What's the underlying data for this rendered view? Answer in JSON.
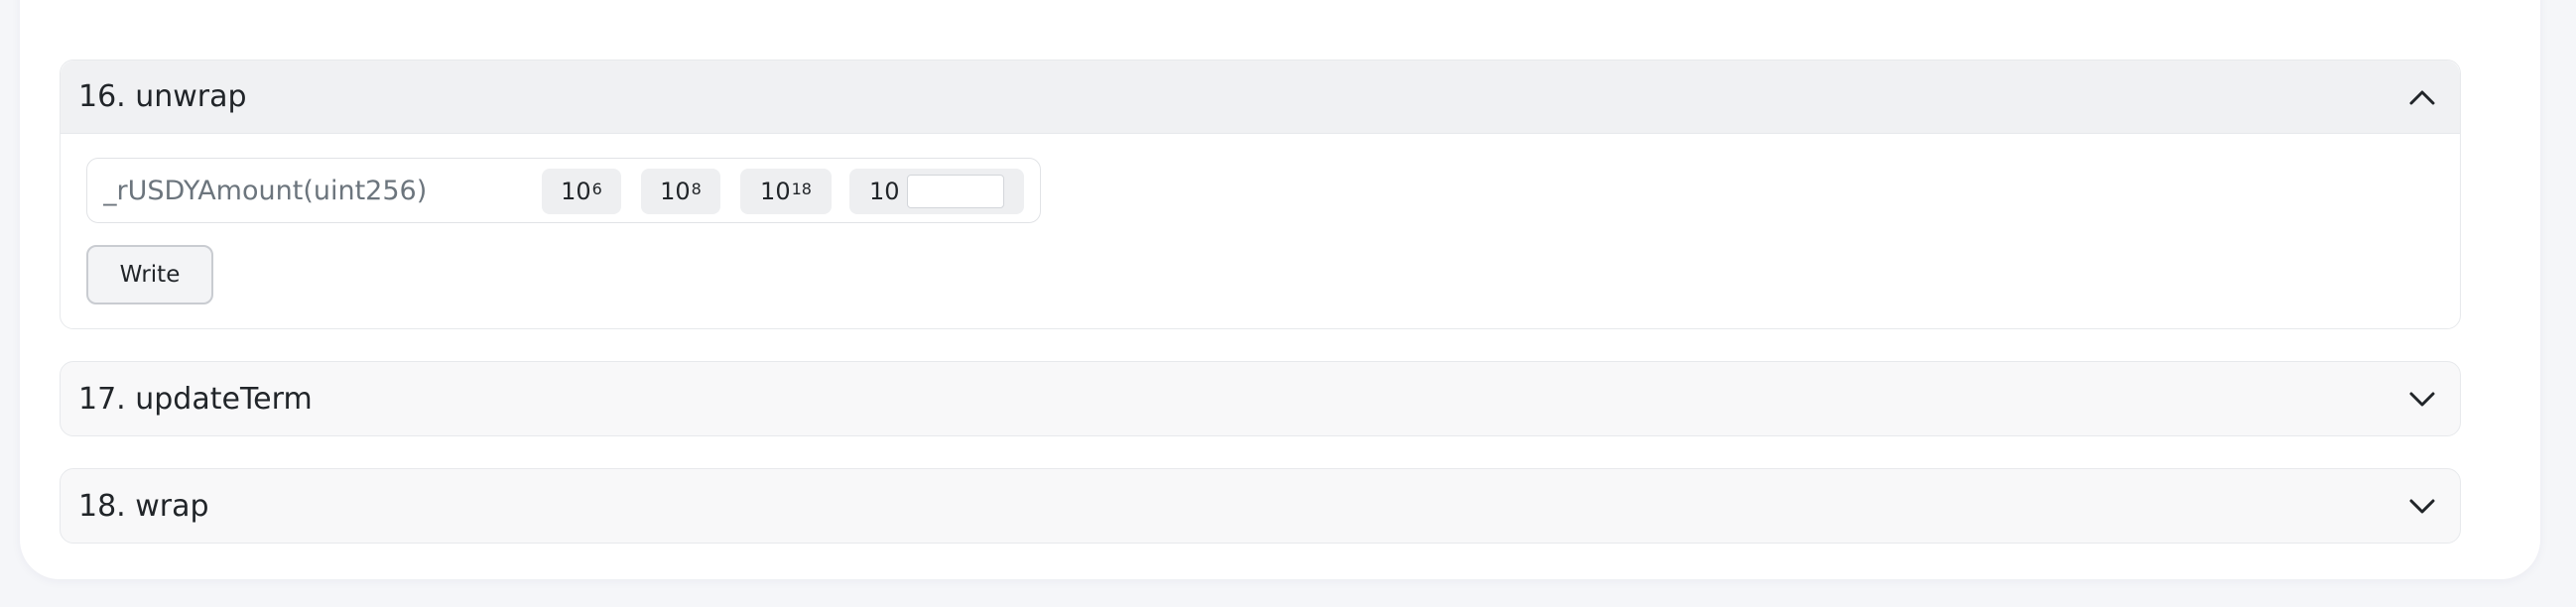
{
  "functions": [
    {
      "title": "16. unwrap",
      "expanded": true,
      "chevron_icon": "chevron-up-icon",
      "param_placeholder": "_rUSDYAmount(uint256)",
      "param_value": "",
      "power_buttons": [
        {
          "base": "10",
          "exp": "6"
        },
        {
          "base": "10",
          "exp": "8"
        },
        {
          "base": "10",
          "exp": "18"
        }
      ],
      "custom_power": {
        "base": "10",
        "exp_value": ""
      },
      "write_label": "Write"
    },
    {
      "title": "17. updateTerm",
      "expanded": false,
      "chevron_icon": "chevron-down-icon"
    },
    {
      "title": "18. wrap",
      "expanded": false,
      "chevron_icon": "chevron-down-icon"
    }
  ]
}
